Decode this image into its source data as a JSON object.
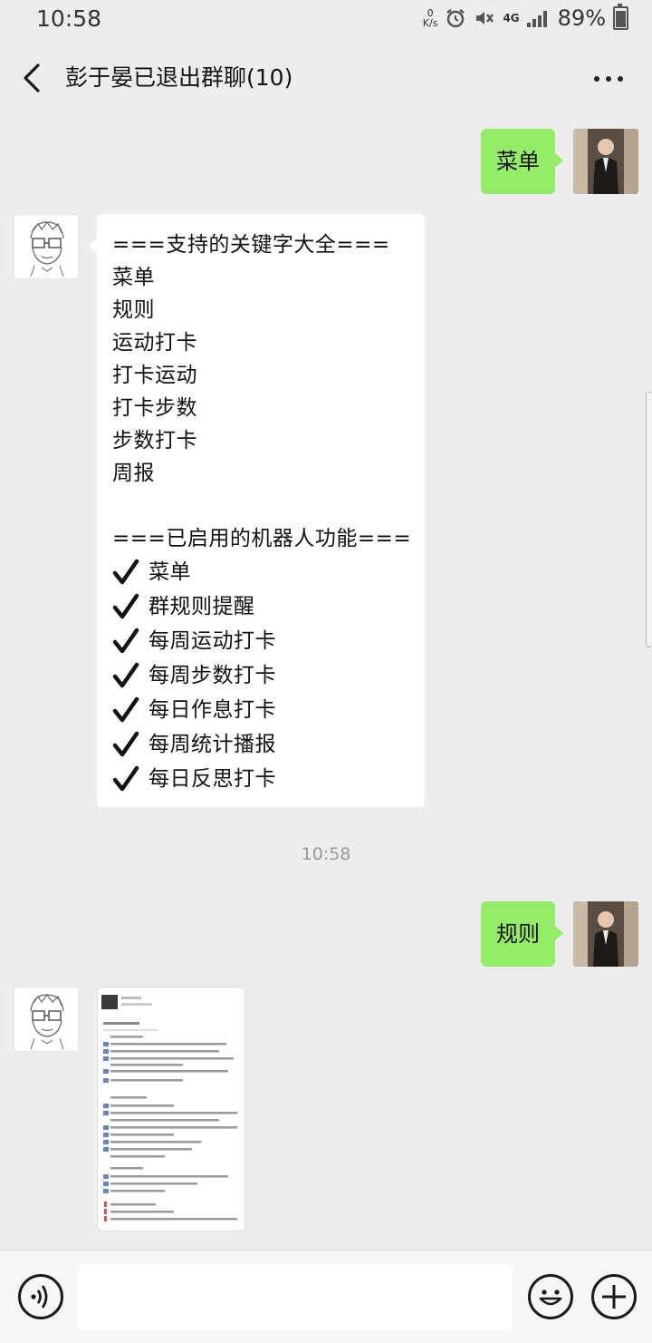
{
  "status_bar": {
    "time": "10:58",
    "net_speed_top": "0",
    "net_speed_unit": "K/s",
    "network": "4G",
    "battery": "89%"
  },
  "header": {
    "title": "彭于晏已退出群聊(10)",
    "back_icon": "chevron-left-icon",
    "more_icon": "more-dots-icon"
  },
  "messages": {
    "m1": {
      "text": "菜单"
    },
    "m2": {
      "lines": [
        "===支持的关键字大全===",
        "菜单",
        "规则",
        "运动打卡",
        "打卡运动",
        "打卡步数",
        "步数打卡",
        "周报",
        "",
        "===已启用的机器人功能==="
      ],
      "features": [
        "菜单",
        "群规则提醒",
        "每周运动打卡",
        "每周步数打卡",
        "每日作息打卡",
        "每周统计播报",
        "每日反思打卡"
      ]
    },
    "time_divider": "10:58",
    "m3": {
      "text": "规则"
    }
  },
  "input_bar": {
    "voice_icon": "voice-icon",
    "emoji_icon": "emoji-icon",
    "plus_icon": "plus-icon"
  },
  "colors": {
    "background": "#ededed",
    "outgoing_bubble": "#95ec69",
    "incoming_bubble": "#ffffff"
  }
}
